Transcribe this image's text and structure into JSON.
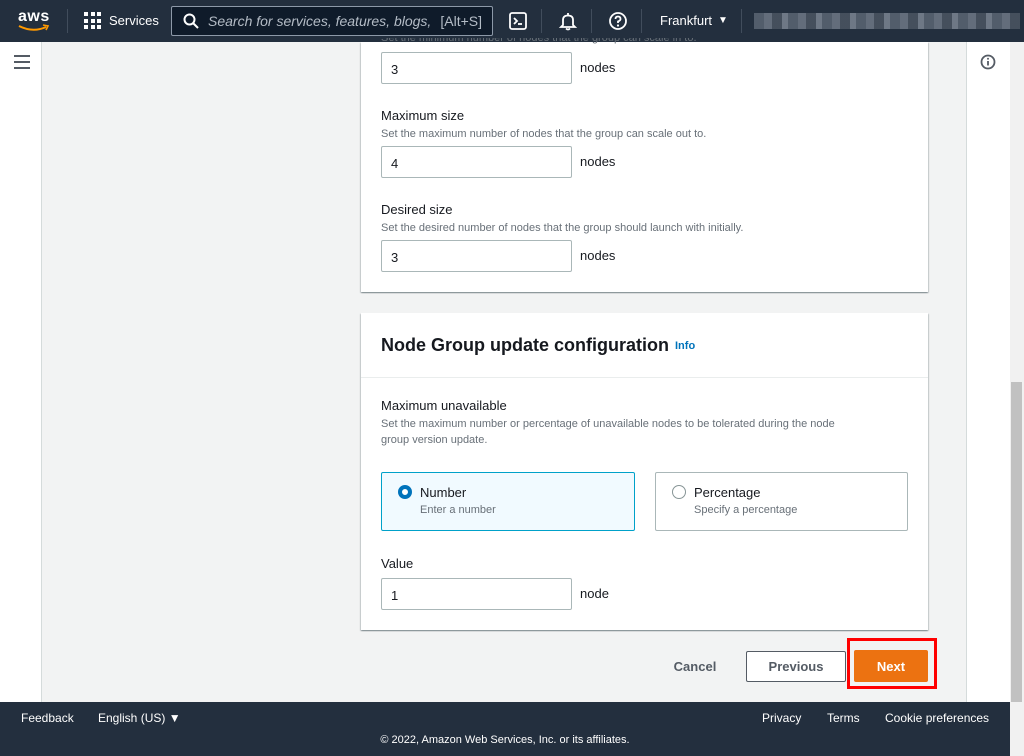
{
  "topnav": {
    "logo_text": "aws",
    "services_label": "Services",
    "search_placeholder": "Search for services, features, blogs,",
    "search_hint": "[Alt+S]",
    "region": "Frankfurt"
  },
  "form": {
    "cut_off_description": "Set the minimum number of nodes that the group can scale in to.",
    "min_size_value": "3",
    "min_size_unit": "nodes",
    "max_size": {
      "label": "Maximum size",
      "description": "Set the maximum number of nodes that the group can scale out to.",
      "value": "4",
      "unit": "nodes"
    },
    "desired_size": {
      "label": "Desired size",
      "description": "Set the desired number of nodes that the group should launch with initially.",
      "value": "3",
      "unit": "nodes"
    }
  },
  "update_config": {
    "title": "Node Group update configuration",
    "info_link": "Info",
    "max_unavailable_label": "Maximum unavailable",
    "max_unavailable_desc_line1": "Set the maximum number or percentage of unavailable nodes to be tolerated during the node",
    "max_unavailable_desc_line2": "group version update.",
    "options": [
      {
        "label": "Number",
        "description": "Enter a number",
        "selected": true
      },
      {
        "label": "Percentage",
        "description": "Specify a percentage",
        "selected": false
      }
    ],
    "value_label": "Value",
    "value": "1",
    "value_unit": "node"
  },
  "actions": {
    "cancel": "Cancel",
    "previous": "Previous",
    "next": "Next"
  },
  "footer": {
    "feedback": "Feedback",
    "language": "English (US) ▼",
    "privacy": "Privacy",
    "terms": "Terms",
    "cookie": "Cookie preferences",
    "copyright": "© 2022, Amazon Web Services, Inc. or its affiliates."
  },
  "colors": {
    "nav_bg": "#232f3e",
    "primary_button": "#ec7211",
    "link": "#0073bb",
    "highlight": "#ff0000"
  }
}
